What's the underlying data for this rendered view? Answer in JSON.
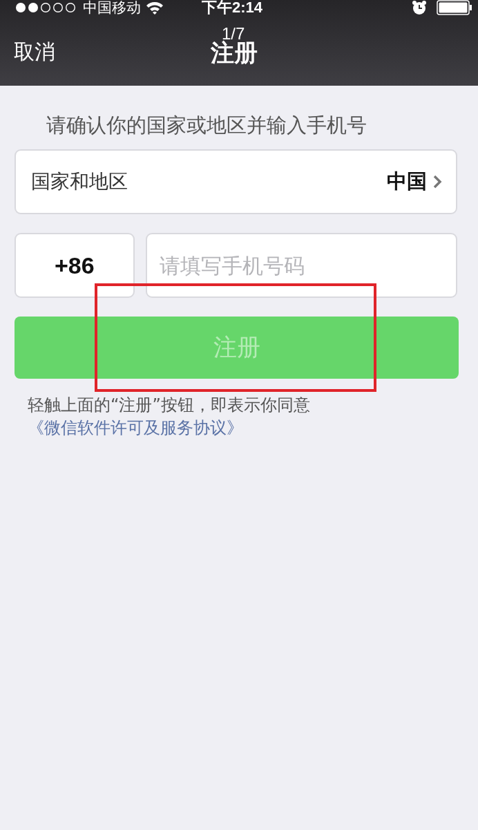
{
  "status_bar": {
    "carrier": "中国移动",
    "time": "下午2:14"
  },
  "nav": {
    "cancel": "取消",
    "title": "注册",
    "counter": "1/7"
  },
  "heading": "请确认你的国家或地区并输入手机号",
  "country_row": {
    "label": "国家和地区",
    "value": "中国"
  },
  "phone": {
    "code": "+86",
    "placeholder": "请填写手机号码"
  },
  "register_button": {
    "label": "注册",
    "disabled": true
  },
  "note": {
    "text": "轻触上面的“注册”按钮，即表示你同意",
    "link": "《微信软件许可及服务协议》"
  },
  "highlight": {
    "kind": "rectangle",
    "color": "#e0242a"
  }
}
